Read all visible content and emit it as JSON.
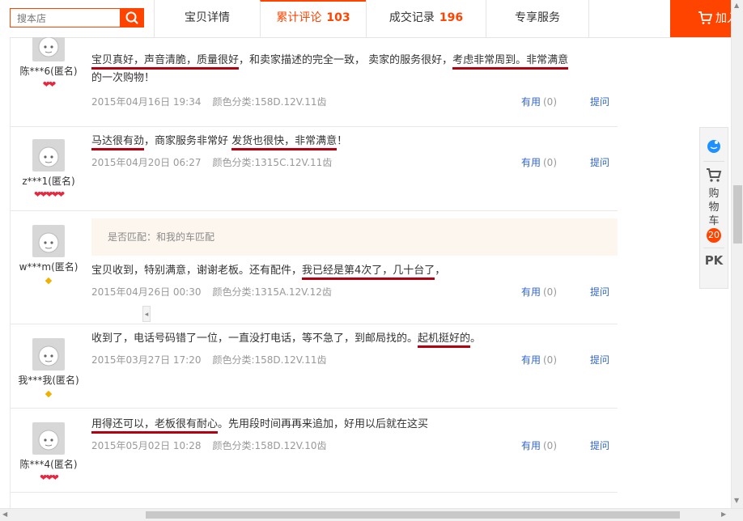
{
  "search": {
    "placeholder": "搜本店"
  },
  "tabs": [
    {
      "label": "宝贝详情",
      "count": ""
    },
    {
      "label": "累计评论",
      "count": "103"
    },
    {
      "label": "成交记录",
      "count": "196"
    },
    {
      "label": "专享服务",
      "count": ""
    }
  ],
  "cart_button": {
    "label": "加入购物车"
  },
  "reviews": [
    {
      "user": "陈***6(匿名)",
      "level": "hearts-2",
      "text_parts": [
        "宝贝真好，声音清脆，质量很好",
        "，和卖家描述的完全一致， 卖家的服务很好，",
        "考虑非常周到。非常满意",
        "的一次购物！"
      ],
      "date": "2015年04月16日 19:34",
      "spec": "颜色分类:158D.12V.11齿",
      "useful": "有用",
      "useful_count": "(0)",
      "ask": "提问"
    },
    {
      "user": "z***1(匿名)",
      "level": "hearts-5",
      "text_parts": [
        "马达很有劲",
        "，商家服务非常好 ",
        "发货也很快，非常满意",
        "！"
      ],
      "date": "2015年04月20日 06:27",
      "spec": "颜色分类:1315C.12V.11齿",
      "useful": "有用",
      "useful_count": "(0)",
      "ask": "提问"
    },
    {
      "user": "w***m(匿名)",
      "level": "diamond-1",
      "match_text": "是否匹配：和我的车匹配",
      "text_parts": [
        "宝贝收到，特别满意，谢谢老板。还有配件，",
        "我已经是第4次了，几十台了",
        "，"
      ],
      "date": "2015年04月26日 00:30",
      "spec": "颜色分类:1315A.12V.12齿",
      "useful": "有用",
      "useful_count": "(0)",
      "ask": "提问"
    },
    {
      "user": "我***我(匿名)",
      "level": "diamond-1",
      "text_parts": [
        "收到了，电话号码错了一位，一直没打电话，等不急了，到邮局找的。",
        "起机挺好的",
        "。"
      ],
      "date": "2015年03月27日 17:20",
      "spec": "颜色分类:158D.12V.11齿",
      "useful": "有用",
      "useful_count": "(0)",
      "ask": "提问"
    },
    {
      "user": "陈***4(匿名)",
      "level": "hearts-3",
      "text_parts": [
        "用得还可以，老板很有耐心",
        "。先用段时间再再来追加，好用以后就在这买"
      ],
      "date": "2015年05月02日 10:28",
      "spec": "颜色分类:158D.12V.10齿",
      "useful": "有用",
      "useful_count": "(0)",
      "ask": "提问"
    }
  ],
  "side_tools": {
    "cart_label": "购物车",
    "cart_count": "20",
    "pk_label": "PK"
  },
  "colors": {
    "accent": "#ff4400",
    "underline": "#b40010",
    "link": "#3366cc",
    "heart": "#e8263f",
    "diamond": "#f0b000"
  }
}
